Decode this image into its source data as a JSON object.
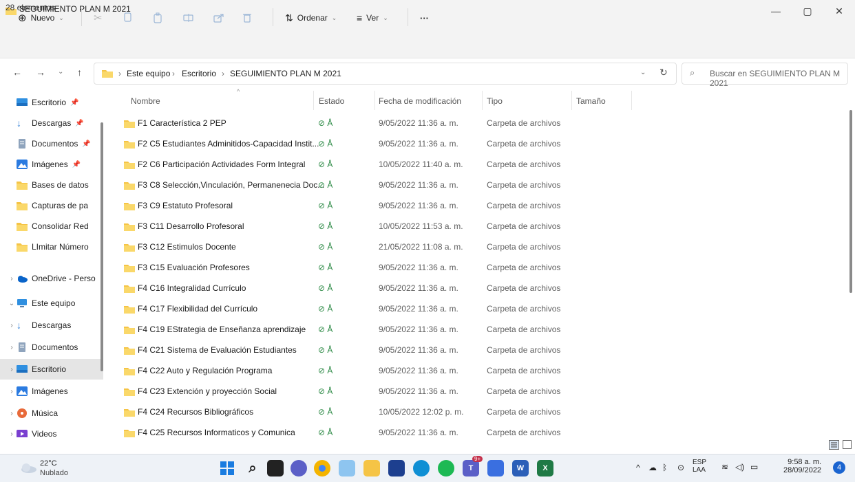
{
  "window": {
    "title": "SEGUIMIENTO PLAN M 2021",
    "minimize": "—",
    "maximize": "▢",
    "close": "✕"
  },
  "toolbar": {
    "new_label": "Nuevo",
    "sort_label": "Ordenar",
    "view_label": "Ver",
    "more_label": "···"
  },
  "address": {
    "crumbs": [
      "Este equipo",
      "Escritorio",
      "SEGUIMIENTO PLAN M 2021"
    ],
    "search_placeholder": "Buscar en SEGUIMIENTO PLAN M 2021"
  },
  "nav": {
    "quick_access": [
      {
        "label": "Escritorio",
        "icon": "desktop-icon",
        "pinned": true
      },
      {
        "label": "Descargas",
        "icon": "download-icon",
        "pinned": true
      },
      {
        "label": "Documentos",
        "icon": "documents-icon",
        "pinned": true
      },
      {
        "label": "Imágenes",
        "icon": "pictures-icon",
        "pinned": true
      },
      {
        "label": "Bases de datos",
        "icon": "folder-icon",
        "pinned": false
      },
      {
        "label": "Capturas de pa",
        "icon": "folder-icon",
        "pinned": false
      },
      {
        "label": "Consolidar Red",
        "icon": "folder-icon",
        "pinned": false
      },
      {
        "label": "LImitar Número",
        "icon": "folder-icon",
        "pinned": false
      }
    ],
    "onedrive": "OneDrive - Perso",
    "this_pc": "Este equipo",
    "pc_items": [
      {
        "label": "Descargas",
        "icon": "download-icon"
      },
      {
        "label": "Documentos",
        "icon": "documents-icon"
      },
      {
        "label": "Escritorio",
        "icon": "desktop-icon",
        "selected": true
      },
      {
        "label": "Imágenes",
        "icon": "pictures-icon"
      },
      {
        "label": "Música",
        "icon": "music-icon"
      },
      {
        "label": "Videos",
        "icon": "videos-icon"
      }
    ]
  },
  "columns": {
    "name": "Nombre",
    "state": "Estado",
    "date": "Fecha de modificación",
    "type": "Tipo",
    "size": "Tamaño"
  },
  "files": [
    {
      "name": "F1 Característica 2 PEP",
      "state": "⊘ Å",
      "date": "9/05/2022 11:36 a. m.",
      "type": "Carpeta de archivos"
    },
    {
      "name": "F2 C5 Estudiantes Adminitidos-Capacidad Instit...",
      "state": "⊘ Å",
      "date": "9/05/2022 11:36 a. m.",
      "type": "Carpeta de archivos"
    },
    {
      "name": "F2 C6 Participación Actividades Form Integral",
      "state": "⊘ Å",
      "date": "10/05/2022 11:40 a. m.",
      "type": "Carpeta de archivos"
    },
    {
      "name": "F3 C8 Selección,Vinculación, Permanenecia Doc...",
      "state": "⊘ Å",
      "date": "9/05/2022 11:36 a. m.",
      "type": "Carpeta de archivos"
    },
    {
      "name": "F3 C9 Estatuto Profesoral",
      "state": "⊘ Å",
      "date": "9/05/2022 11:36 a. m.",
      "type": "Carpeta de archivos"
    },
    {
      "name": "F3 C11 Desarrollo Profesoral",
      "state": "⊘ Å",
      "date": "10/05/2022 11:53 a. m.",
      "type": "Carpeta de archivos"
    },
    {
      "name": "F3 C12 Estimulos Docente",
      "state": "⊘ Å",
      "date": "21/05/2022 11:08 a. m.",
      "type": "Carpeta de archivos"
    },
    {
      "name": "F3 C15 Evaluación Profesores",
      "state": "⊘ Å",
      "date": "9/05/2022 11:36 a. m.",
      "type": "Carpeta de archivos"
    },
    {
      "name": "F4 C16 Integralidad Currículo",
      "state": "⊘ Å",
      "date": "9/05/2022 11:36 a. m.",
      "type": "Carpeta de archivos"
    },
    {
      "name": "F4 C17 Flexibilidad del Currículo",
      "state": "⊘ Å",
      "date": "9/05/2022 11:36 a. m.",
      "type": "Carpeta de archivos"
    },
    {
      "name": "F4 C19 EStrategia de Enseñanza aprendizaje",
      "state": "⊘ Å",
      "date": "9/05/2022 11:36 a. m.",
      "type": "Carpeta de archivos"
    },
    {
      "name": "F4 C21 Sistema de Evaluación Estudiantes",
      "state": "⊘ Å",
      "date": "9/05/2022 11:36 a. m.",
      "type": "Carpeta de archivos"
    },
    {
      "name": "F4 C22 Auto y Regulación Programa",
      "state": "⊘ Å",
      "date": "9/05/2022 11:36 a. m.",
      "type": "Carpeta de archivos"
    },
    {
      "name": "F4 C23 Extención y proyección Social",
      "state": "⊘ Å",
      "date": "9/05/2022 11:36 a. m.",
      "type": "Carpeta de archivos"
    },
    {
      "name": "F4 C24 Recursos Bibliográficos",
      "state": "⊘ Å",
      "date": "10/05/2022 12:02 p. m.",
      "type": "Carpeta de archivos"
    },
    {
      "name": "F4 C25 Recursos Informaticos y Comunica",
      "state": "⊘ Å",
      "date": "9/05/2022 11:36 a. m.",
      "type": "Carpeta de archivos"
    }
  ],
  "status": {
    "count": "28 elementos"
  },
  "taskbar": {
    "weather_temp": "22°C",
    "weather_desc": "Nublado",
    "lang_1": "ESP",
    "lang_2": "LAA",
    "time": "9:58 a. m.",
    "date": "28/09/2022",
    "notifications": "4",
    "teams_badge": "9+"
  },
  "colors": {
    "folder": "#f5c446",
    "sync_green": "#2c8a45",
    "selection": "#e5e5e5"
  }
}
